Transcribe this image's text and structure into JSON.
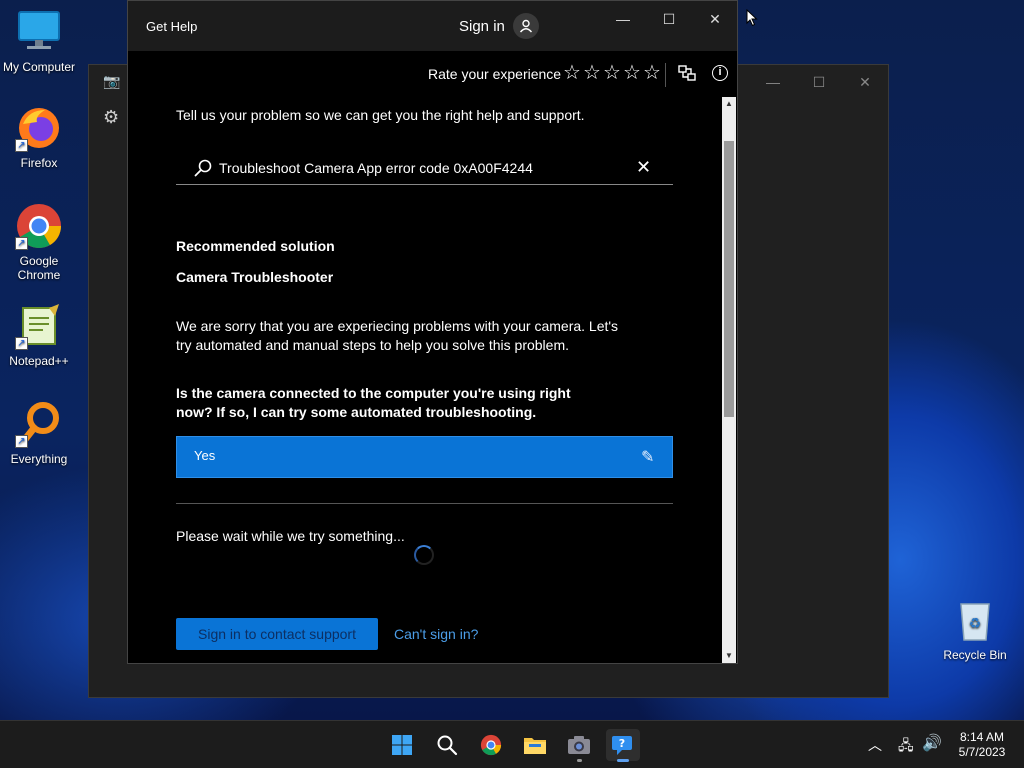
{
  "desktop": {
    "icons": [
      {
        "label": "My Computer"
      },
      {
        "label": "Firefox"
      },
      {
        "label": "Google Chrome"
      },
      {
        "label": "Notepad++"
      },
      {
        "label": "Everything"
      },
      {
        "label": "Recycle Bin"
      }
    ]
  },
  "help_window": {
    "title": "Get Help",
    "sign_in": "Sign in",
    "rate_label": "Rate your experience",
    "stars": [
      "☆",
      "☆",
      "☆",
      "☆",
      "☆"
    ],
    "intro": "Tell us your problem so we can get you the right help and support.",
    "search_value": "Troubleshoot Camera App error code 0xA00F4244",
    "recommended_label": "Recommended solution",
    "solution_title": "Camera Troubleshooter",
    "paragraph": "We are sorry that you are experiecing problems with your camera. Let's try automated and manual steps to help you solve this problem.",
    "question": "Is the camera connected to the computer you're using right now? If so, I can try some automated troubleshooting.",
    "answer": "Yes",
    "wait_text": "Please wait while we try something...",
    "contact_button": "Sign in to contact support",
    "cant_sign_in": "Can't sign in?"
  },
  "taskbar": {
    "time": "8:14 AM",
    "date": "5/7/2023"
  },
  "colors": {
    "accent": "#0a74d6",
    "link": "#4c9ee8"
  }
}
